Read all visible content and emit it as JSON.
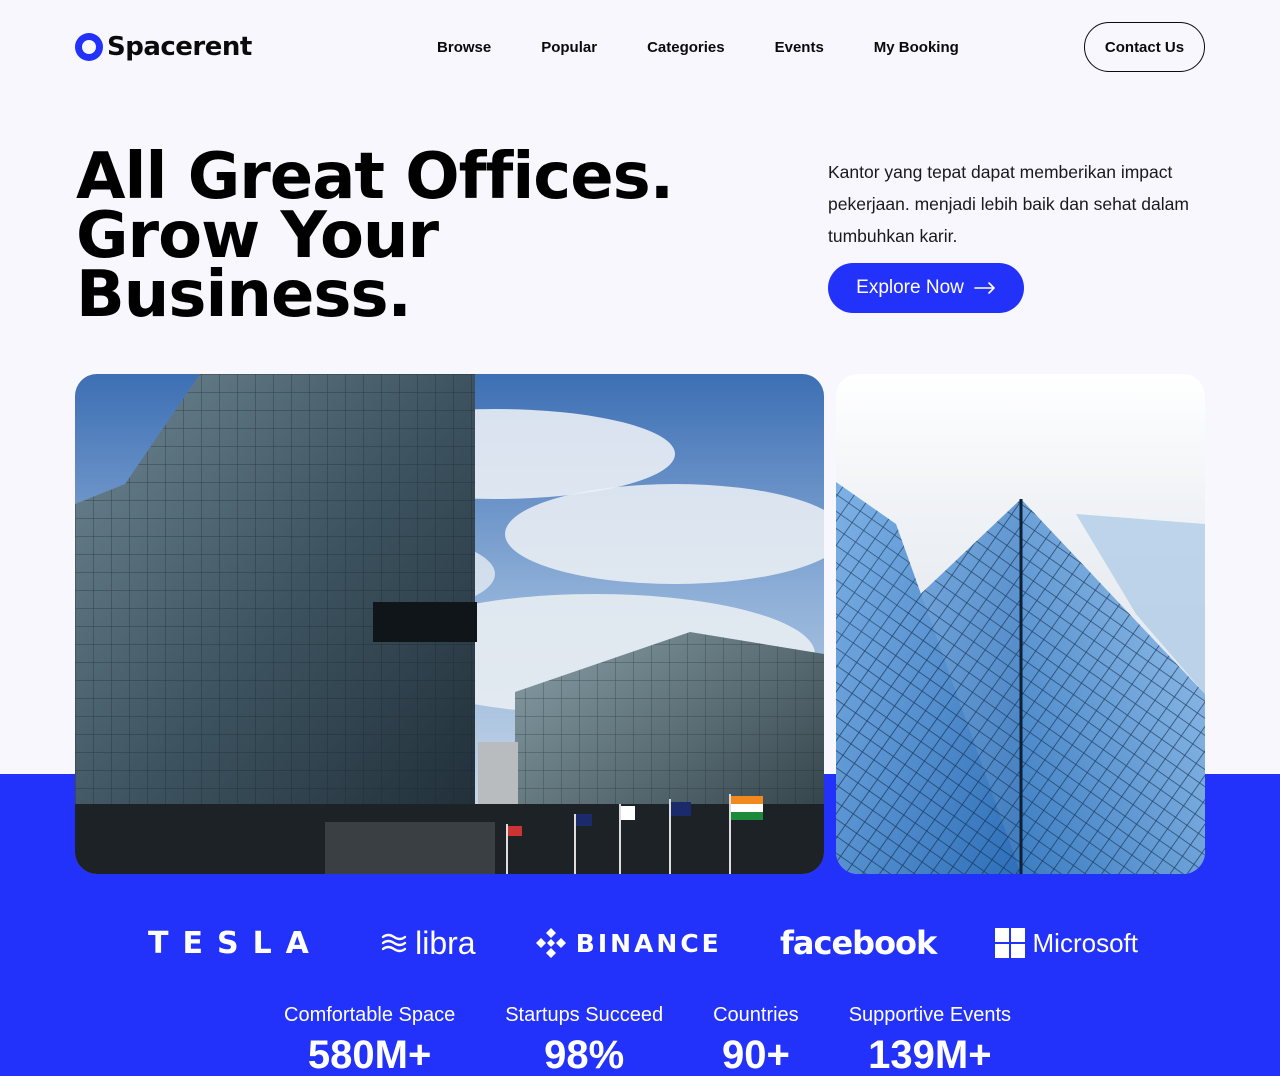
{
  "colors": {
    "accent": "#2332fb",
    "background": "#f7f7fd",
    "text": "#0b0b0b"
  },
  "brand": {
    "name": "Spacerent",
    "logo_icon": "ring-logo-icon"
  },
  "nav": {
    "items": [
      {
        "label": "Browse"
      },
      {
        "label": "Popular"
      },
      {
        "label": "Categories"
      },
      {
        "label": "Events"
      },
      {
        "label": "My Booking"
      }
    ],
    "contact_label": "Contact Us"
  },
  "hero": {
    "headline": [
      "All Great Offices.",
      "Grow Your",
      "Business."
    ],
    "description": "Kantor yang tepat dapat memberikan impact pekerjaan. menjadi lebih baik dan sehat dalam tumbuhkan karir.",
    "cta_label": "Explore Now",
    "cta_icon": "arrow-right-icon"
  },
  "images": {
    "left": "glass-office-buildings-photo",
    "right": "skyscraper-looking-up-photo"
  },
  "partners": [
    {
      "name": "TESLA",
      "icon": "tesla-logo"
    },
    {
      "name": "libra",
      "icon": "libra-waves-icon"
    },
    {
      "name": "BINANCE",
      "icon": "binance-diamond-icon"
    },
    {
      "name": "facebook",
      "icon": "facebook-wordmark"
    },
    {
      "name": "Microsoft",
      "icon": "microsoft-squares-icon"
    }
  ],
  "stats": [
    {
      "label": "Comfortable Space",
      "value": "580M+"
    },
    {
      "label": "Startups Succeed",
      "value": "98%"
    },
    {
      "label": "Countries",
      "value": "90+"
    },
    {
      "label": "Supportive Events",
      "value": "139M+"
    }
  ]
}
